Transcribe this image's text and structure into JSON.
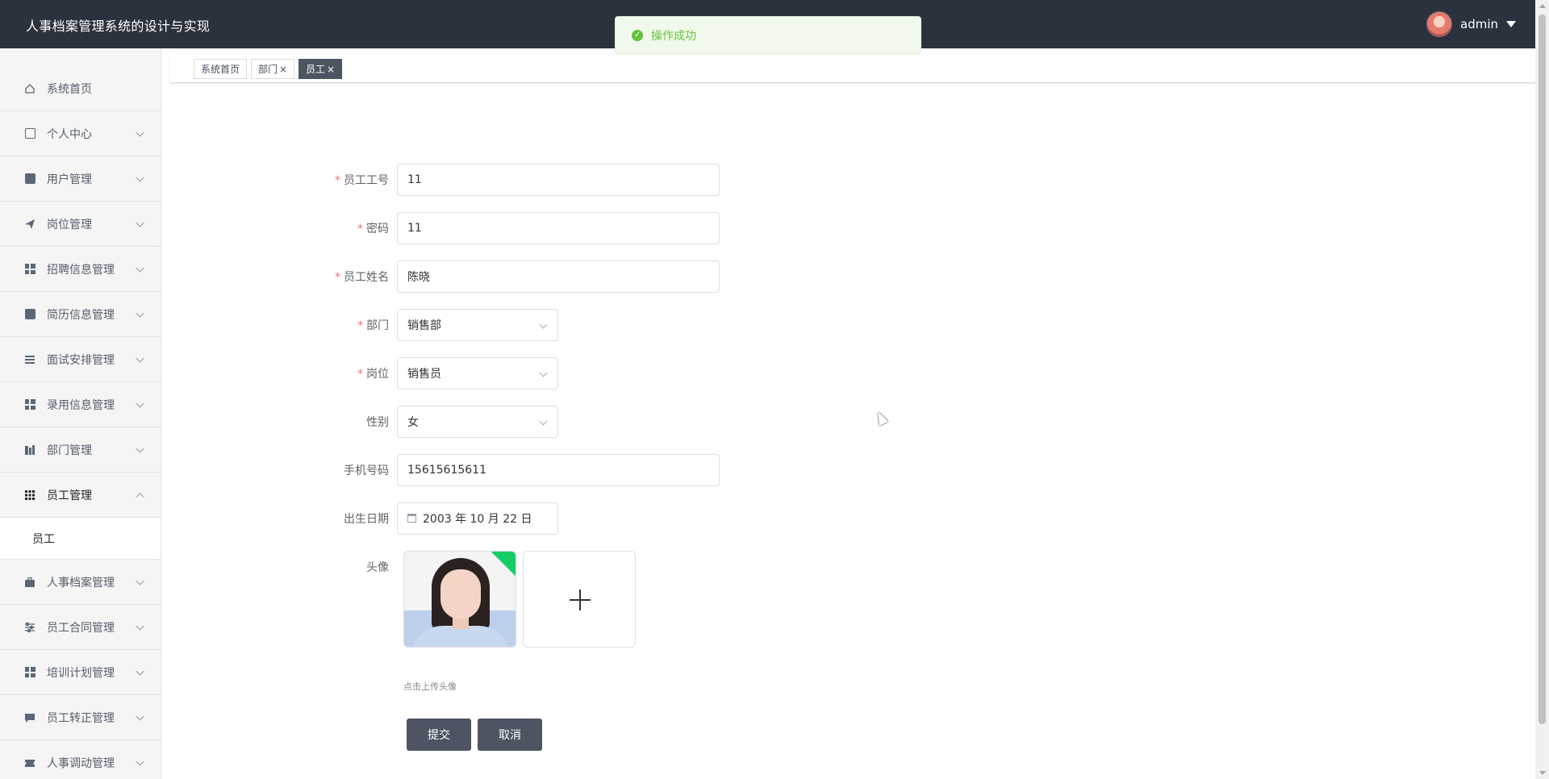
{
  "header": {
    "app_title": "人事档案管理系统的设计与实现",
    "user_name": "admin",
    "colors": {
      "bar": "#2b323e",
      "text": "#ffffff"
    }
  },
  "toast": {
    "message": "操作成功",
    "type": "success",
    "color": "#67c23a"
  },
  "sidebar": {
    "items": [
      {
        "label": "系统首页",
        "icon": "home-icon",
        "expandable": false
      },
      {
        "label": "个人中心",
        "icon": "wallet-icon",
        "expandable": true
      },
      {
        "label": "用户管理",
        "icon": "clipboard-icon",
        "expandable": true
      },
      {
        "label": "岗位管理",
        "icon": "send-icon",
        "expandable": true
      },
      {
        "label": "招聘信息管理",
        "icon": "grid-icon",
        "expandable": true
      },
      {
        "label": "简历信息管理",
        "icon": "checklist-icon",
        "expandable": true
      },
      {
        "label": "面试安排管理",
        "icon": "list-icon",
        "expandable": true
      },
      {
        "label": "录用信息管理",
        "icon": "grid-icon",
        "expandable": true
      },
      {
        "label": "部门管理",
        "icon": "building-icon",
        "expandable": true
      },
      {
        "label": "员工管理",
        "icon": "grid-dense-icon",
        "expandable": true,
        "expanded": true,
        "children": [
          {
            "label": "员工"
          }
        ]
      },
      {
        "label": "人事档案管理",
        "icon": "briefcase-icon",
        "expandable": true
      },
      {
        "label": "员工合同管理",
        "icon": "sliders-icon",
        "expandable": true
      },
      {
        "label": "培训计划管理",
        "icon": "grid-icon",
        "expandable": true
      },
      {
        "label": "员工转正管理",
        "icon": "chat-icon",
        "expandable": true
      },
      {
        "label": "人事调动管理",
        "icon": "ticket-icon",
        "expandable": true
      }
    ]
  },
  "tabs": [
    {
      "label": "系统首页",
      "closable": false,
      "active": false
    },
    {
      "label": "部门",
      "closable": true,
      "active": false
    },
    {
      "label": "员工",
      "closable": true,
      "active": true
    }
  ],
  "tab_close_glyph": "×",
  "form": {
    "employee_no": {
      "label": "员工工号",
      "required": true,
      "value": "11"
    },
    "password": {
      "label": "密码",
      "required": true,
      "value": "11"
    },
    "employee_name": {
      "label": "员工姓名",
      "required": true,
      "value": "陈晓"
    },
    "department": {
      "label": "部门",
      "required": true,
      "value": "销售部"
    },
    "position": {
      "label": "岗位",
      "required": true,
      "value": "销售员"
    },
    "gender": {
      "label": "性别",
      "required": false,
      "value": "女"
    },
    "phone": {
      "label": "手机号码",
      "required": false,
      "value": "15615615611"
    },
    "birthday": {
      "label": "出生日期",
      "required": false,
      "value": "2003 年 10 月 22 日"
    },
    "avatar": {
      "label": "头像",
      "tip": "点击上传头像"
    },
    "required_mark": "*",
    "submit_label": "提交",
    "cancel_label": "取消"
  }
}
